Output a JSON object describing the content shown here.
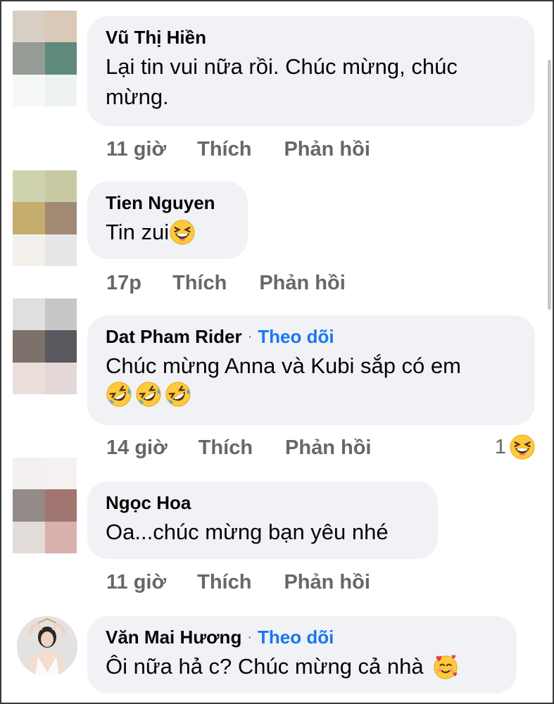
{
  "comments": [
    {
      "author": "Vũ Thị Hiền",
      "follow": "",
      "text": "Lại tin vui nữa rồi. Chúc mừng, chúc mừng.",
      "time": "11 giờ",
      "like": "Thích",
      "reply": "Phản hồi",
      "avatar_colors": [
        "#d7cfc3",
        "#d9c9b6",
        "#959c96",
        "#5e8a7e",
        "#f6f7f7",
        "#eef2f2"
      ]
    },
    {
      "author": "Tien Nguyen",
      "follow": "",
      "text": "Tin zui",
      "emojis": [
        "laughing-emoji"
      ],
      "time": "17p",
      "like": "Thích",
      "reply": "Phản hồi",
      "avatar_colors": [
        "#ced2af",
        "#c9c9a4",
        "#c5ad6d",
        "#a08a74",
        "#f4f1ed",
        "#e6e8e8"
      ]
    },
    {
      "author": "Dat Pham Rider",
      "follow": "Theo dõi",
      "text": "Chúc mừng Anna và Kubi sắp có em",
      "emojis": [
        "rofl-emoji",
        "rofl-emoji",
        "rofl-emoji"
      ],
      "time": "14 giờ",
      "like": "Thích",
      "reply": "Phản hồi",
      "reaction_count": "1",
      "reaction_icon": "laughing-emoji",
      "avatar_colors": [
        "#e0dfdf",
        "#c8c7c8",
        "#7d716c",
        "#58585f",
        "#eadedb",
        "#e4d7d7"
      ]
    },
    {
      "author": "Ngọc Hoa",
      "follow": "",
      "text": "Oa...chúc mừng bạn yêu nhé",
      "time": "11 giờ",
      "like": "Thích",
      "reply": "Phản hồi",
      "avatar_colors": [
        "#f4f0f0",
        "#f5f1f1",
        "#948a87",
        "#a17570",
        "#e2dcda",
        "#d9b1ac"
      ]
    },
    {
      "author": "Văn Mai Hương",
      "follow": "Theo dõi",
      "text": "Ôi nữa hả c? Chúc mừng cả nhà",
      "emojis": [
        "smiling-hearts-emoji"
      ],
      "avatar_icon": "profile-photo"
    }
  ],
  "colors": {
    "bubble": "#f0f2f5",
    "meta": "#65676b",
    "link": "#1877f2",
    "emoji": "#ffc93a"
  }
}
